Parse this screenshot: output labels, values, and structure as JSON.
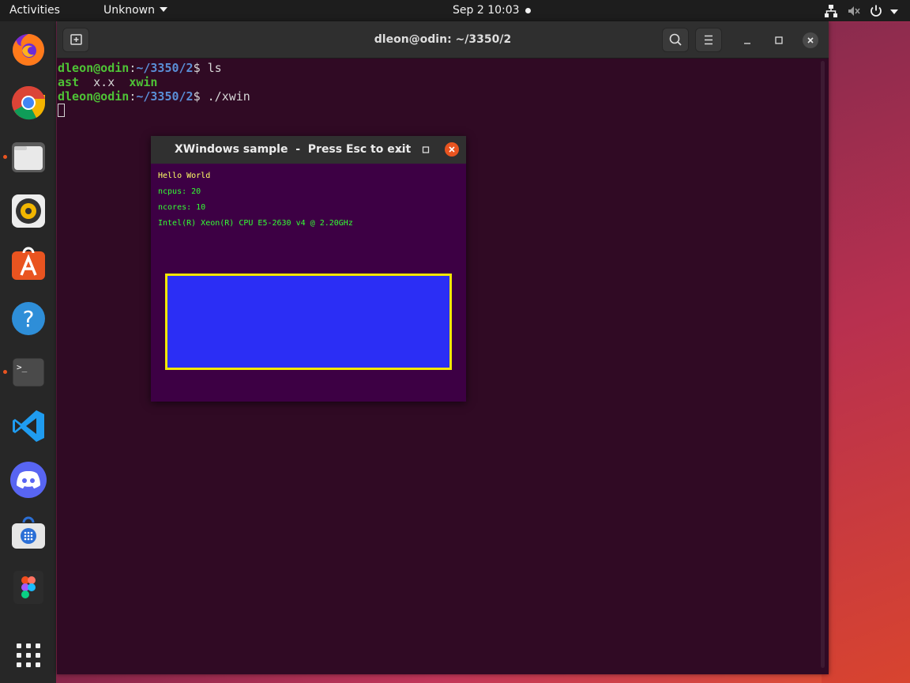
{
  "topbar": {
    "activities": "Activities",
    "app_menu": "Unknown",
    "date": "Sep 2",
    "time": "10:03"
  },
  "dock": {
    "apps": [
      {
        "name": "Firefox",
        "icon": "firefox-icon"
      },
      {
        "name": "Chrome",
        "icon": "chrome-icon"
      },
      {
        "name": "Files",
        "icon": "files-icon",
        "running": true
      },
      {
        "name": "Rhythmbox",
        "icon": "rhythmbox-icon"
      },
      {
        "name": "Ubuntu Software",
        "icon": "software-icon"
      },
      {
        "name": "Help",
        "icon": "help-icon"
      },
      {
        "name": "Terminal",
        "icon": "terminal-icon",
        "running": true
      },
      {
        "name": "Visual Studio Code",
        "icon": "vscode-icon"
      },
      {
        "name": "Discord",
        "icon": "discord-icon"
      },
      {
        "name": "Snap Store",
        "icon": "snapstore-icon"
      },
      {
        "name": "Figma",
        "icon": "figma-icon"
      },
      {
        "name": "Show Applications",
        "icon": "app-grid-icon"
      }
    ]
  },
  "terminal": {
    "title": "dleon@odin: ~/3350/2",
    "lines": [
      {
        "user": "dleon@odin",
        "path": "~/3350/2",
        "cmd": " ls"
      },
      {
        "output": [
          "ast",
          "x.x",
          "xwin"
        ]
      },
      {
        "user": "dleon@odin",
        "path": "~/3350/2",
        "cmd": " ./xwin"
      }
    ]
  },
  "xwin": {
    "title": "XWindows sample  -  Press Esc to exit",
    "text_lines": [
      {
        "text": "Hello World",
        "color": "#ffff66"
      },
      {
        "text": "ncpus: 20",
        "color": "#33ff33"
      },
      {
        "text": "ncores: 10",
        "color": "#33ff33"
      },
      {
        "text": "Intel(R) Xeon(R) CPU E5-2630 v4 @ 2.20GHz",
        "color": "#33ff33"
      }
    ],
    "rect_fill": "#2b2ef5",
    "rect_border": "#f2e600"
  },
  "colors": {
    "accent": "#e95420",
    "terminal_bg": "#300a24",
    "xwin_bg": "#3d0044"
  }
}
